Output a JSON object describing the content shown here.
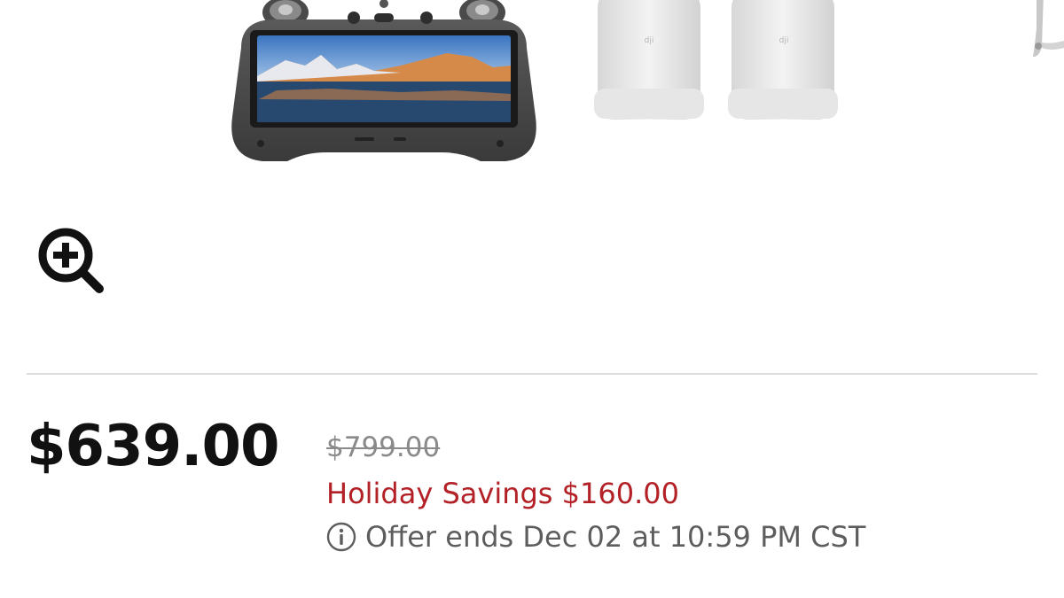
{
  "gallery": {
    "images": [
      "remote-controller-image",
      "intelligent-flight-battery-image",
      "propeller-image"
    ],
    "zoom_icon": "zoom-in-icon"
  },
  "pricing": {
    "current_price": "$639.00",
    "original_price": "$799.00",
    "savings_text": "Holiday Savings $160.00",
    "offer_text": "Offer ends Dec 02 at 10:59 PM CST",
    "info_icon": "info-icon"
  },
  "colors": {
    "savings": "#b32025",
    "muted": "#8a8a8a",
    "divider": "#dcdcdc"
  }
}
